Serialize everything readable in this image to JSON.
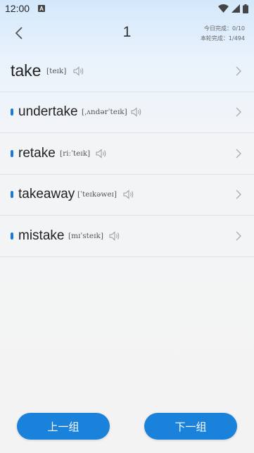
{
  "status_bar": {
    "time": "12:00",
    "notification_badge": "A"
  },
  "header": {
    "title": "1",
    "today_progress": "今日完成：0/10",
    "round_progress": "本轮完成：1/494"
  },
  "words": [
    {
      "word": "take",
      "phonetic": "[teɪk]",
      "is_main": true
    },
    {
      "word": "undertake",
      "phonetic": "[ˌʌndərˈteɪk]",
      "is_main": false
    },
    {
      "word": "retake",
      "phonetic": "[riːˈteɪk]",
      "is_main": false
    },
    {
      "word": "takeaway",
      "phonetic": "[ˈteɪkəweɪ]",
      "is_main": false
    },
    {
      "word": "mistake",
      "phonetic": "[mɪˈsteɪk]",
      "is_main": false
    }
  ],
  "buttons": {
    "prev_label": "上一组",
    "next_label": "下一组"
  },
  "colors": {
    "accent": "#1b82db",
    "dot": "#1a7ad9"
  },
  "icons": {
    "back": "chevron-left-icon",
    "speaker": "speaker-icon",
    "chevron": "chevron-right-icon"
  }
}
